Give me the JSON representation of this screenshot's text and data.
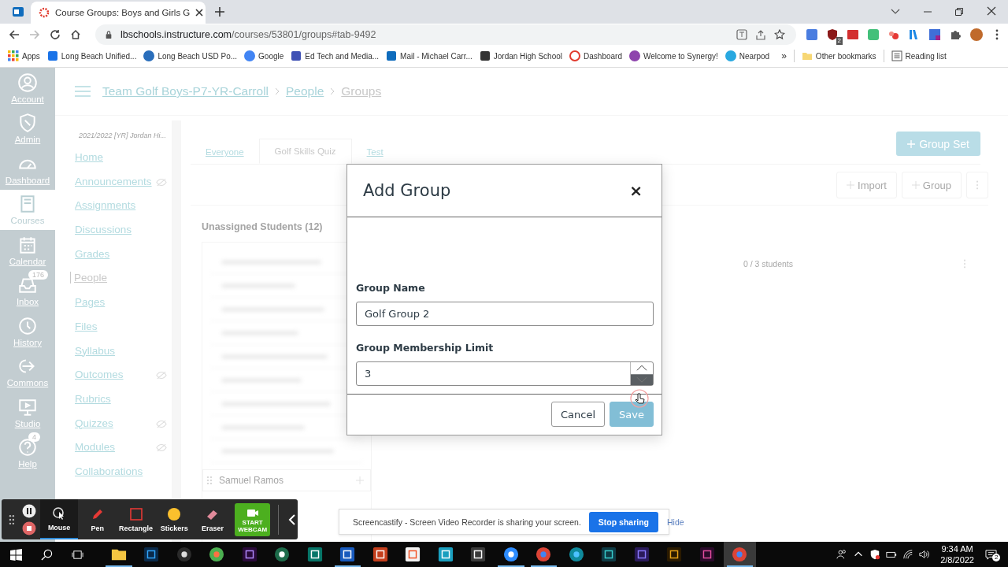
{
  "browser": {
    "tab_title": "Course Groups: Boys and Girls G",
    "url_host": "lbschools.instructure.com",
    "url_path": "/courses/53801/groups#tab-9492",
    "extension_badge": "2",
    "bookmarks": [
      {
        "label": "Apps",
        "kind": "apps"
      },
      {
        "label": "Long Beach Unified...",
        "kind": "calendar"
      },
      {
        "label": "Long Beach USD Po...",
        "kind": "globe"
      },
      {
        "label": "Google",
        "kind": "google"
      },
      {
        "label": "Ed Tech and Media...",
        "kind": "site"
      },
      {
        "label": "Mail - Michael Carr...",
        "kind": "mail"
      },
      {
        "label": "Jordan High School",
        "kind": "school"
      },
      {
        "label": "Dashboard",
        "kind": "ring"
      },
      {
        "label": "Welcome to Synergy!",
        "kind": "swirl"
      },
      {
        "label": "Nearpod",
        "kind": "compass"
      }
    ],
    "overflow": "»",
    "other_bookmarks": "Other bookmarks",
    "reading_list": "Reading list"
  },
  "global_nav": [
    {
      "label": "Account",
      "kind": "account",
      "selected": false
    },
    {
      "label": "Admin",
      "kind": "admin",
      "selected": false
    },
    {
      "label": "Dashboard",
      "kind": "dashboard",
      "selected": false
    },
    {
      "label": "Courses",
      "kind": "courses",
      "selected": true
    },
    {
      "label": "Calendar",
      "kind": "calendar",
      "selected": false
    },
    {
      "label": "Inbox",
      "kind": "inbox",
      "selected": false,
      "badge": "176"
    },
    {
      "label": "History",
      "kind": "history",
      "selected": false
    },
    {
      "label": "Commons",
      "kind": "commons",
      "selected": false
    },
    {
      "label": "Studio",
      "kind": "studio",
      "selected": false
    },
    {
      "label": "Help",
      "kind": "help",
      "selected": false,
      "badge": "4"
    }
  ],
  "breadcrumb": [
    "Team Golf Boys-P7-YR-Carroll",
    "People",
    "Groups"
  ],
  "course_nav": {
    "term": "2021/2022 [YR] Jordan Hi...",
    "items": [
      {
        "label": "Home",
        "selected": false,
        "hidden": false
      },
      {
        "label": "Announcements",
        "selected": false,
        "hidden": true
      },
      {
        "label": "Assignments",
        "selected": false,
        "hidden": false
      },
      {
        "label": "Discussions",
        "selected": false,
        "hidden": false
      },
      {
        "label": "Grades",
        "selected": false,
        "hidden": false
      },
      {
        "label": "People",
        "selected": true,
        "hidden": false
      },
      {
        "label": "Pages",
        "selected": false,
        "hidden": false
      },
      {
        "label": "Files",
        "selected": false,
        "hidden": false
      },
      {
        "label": "Syllabus",
        "selected": false,
        "hidden": false
      },
      {
        "label": "Outcomes",
        "selected": false,
        "hidden": true
      },
      {
        "label": "Rubrics",
        "selected": false,
        "hidden": false
      },
      {
        "label": "Quizzes",
        "selected": false,
        "hidden": true
      },
      {
        "label": "Modules",
        "selected": false,
        "hidden": true
      },
      {
        "label": "Collaborations",
        "selected": false,
        "hidden": false
      }
    ]
  },
  "group_tabs": [
    {
      "label": "Everyone",
      "selected": false
    },
    {
      "label": "Golf Skills Quiz",
      "selected": true
    },
    {
      "label": "Test",
      "selected": false
    }
  ],
  "actions": {
    "group_set": "Group Set",
    "import": "Import",
    "group": "Group"
  },
  "unassigned": {
    "title": "Unassigned Students (12)",
    "visible_student": "Samuel Ramos"
  },
  "group_row": {
    "count": "0 / 3 students"
  },
  "dialog": {
    "title": "Add Group",
    "close": "×",
    "fields": [
      {
        "label": "Group Name",
        "value": "Golf Group 2",
        "kind": "text"
      },
      {
        "label": "Group Membership Limit",
        "value": "3",
        "kind": "number"
      }
    ],
    "buttons": [
      {
        "label": "Cancel",
        "kind": "secondary"
      },
      {
        "label": "Save",
        "kind": "primary"
      }
    ]
  },
  "recorder": {
    "tools": [
      {
        "label": "Mouse",
        "kind": "mouse",
        "selected": true
      },
      {
        "label": "Pen",
        "kind": "pen",
        "selected": false
      },
      {
        "label": "Rectangle",
        "kind": "rectangle",
        "selected": false
      },
      {
        "label": "Stickers",
        "kind": "stickers",
        "selected": false
      },
      {
        "label": "Eraser",
        "kind": "eraser",
        "selected": false
      }
    ],
    "webcam": [
      "START",
      "WEBCAM"
    ]
  },
  "share_bar": {
    "message": "Screencastify - Screen Video Recorder is sharing your screen.",
    "stop": "Stop sharing",
    "hide": "Hide"
  },
  "taskbar": {
    "apps": [
      {
        "kind": "folder",
        "running": true
      },
      {
        "kind": "photo",
        "running": false
      },
      {
        "kind": "aperture",
        "running": false
      },
      {
        "kind": "leaf",
        "running": false
      },
      {
        "kind": "video-edit",
        "running": false
      },
      {
        "kind": "green-circle",
        "running": false
      },
      {
        "kind": "publisher",
        "running": false
      },
      {
        "kind": "word",
        "running": true
      },
      {
        "kind": "slides",
        "running": false
      },
      {
        "kind": "store",
        "running": false
      },
      {
        "kind": "teal",
        "running": false
      },
      {
        "kind": "calculator",
        "running": false
      },
      {
        "kind": "camera",
        "running": true
      },
      {
        "kind": "browser",
        "running": true
      },
      {
        "kind": "wave",
        "running": false
      },
      {
        "kind": "player",
        "running": false
      },
      {
        "kind": "audio",
        "running": false
      },
      {
        "kind": "orange",
        "running": false
      },
      {
        "kind": "triangle",
        "running": false
      },
      {
        "kind": "browser-active",
        "running": true
      }
    ],
    "time": "9:34 AM",
    "date": "2/8/2022",
    "notifications": "2"
  }
}
